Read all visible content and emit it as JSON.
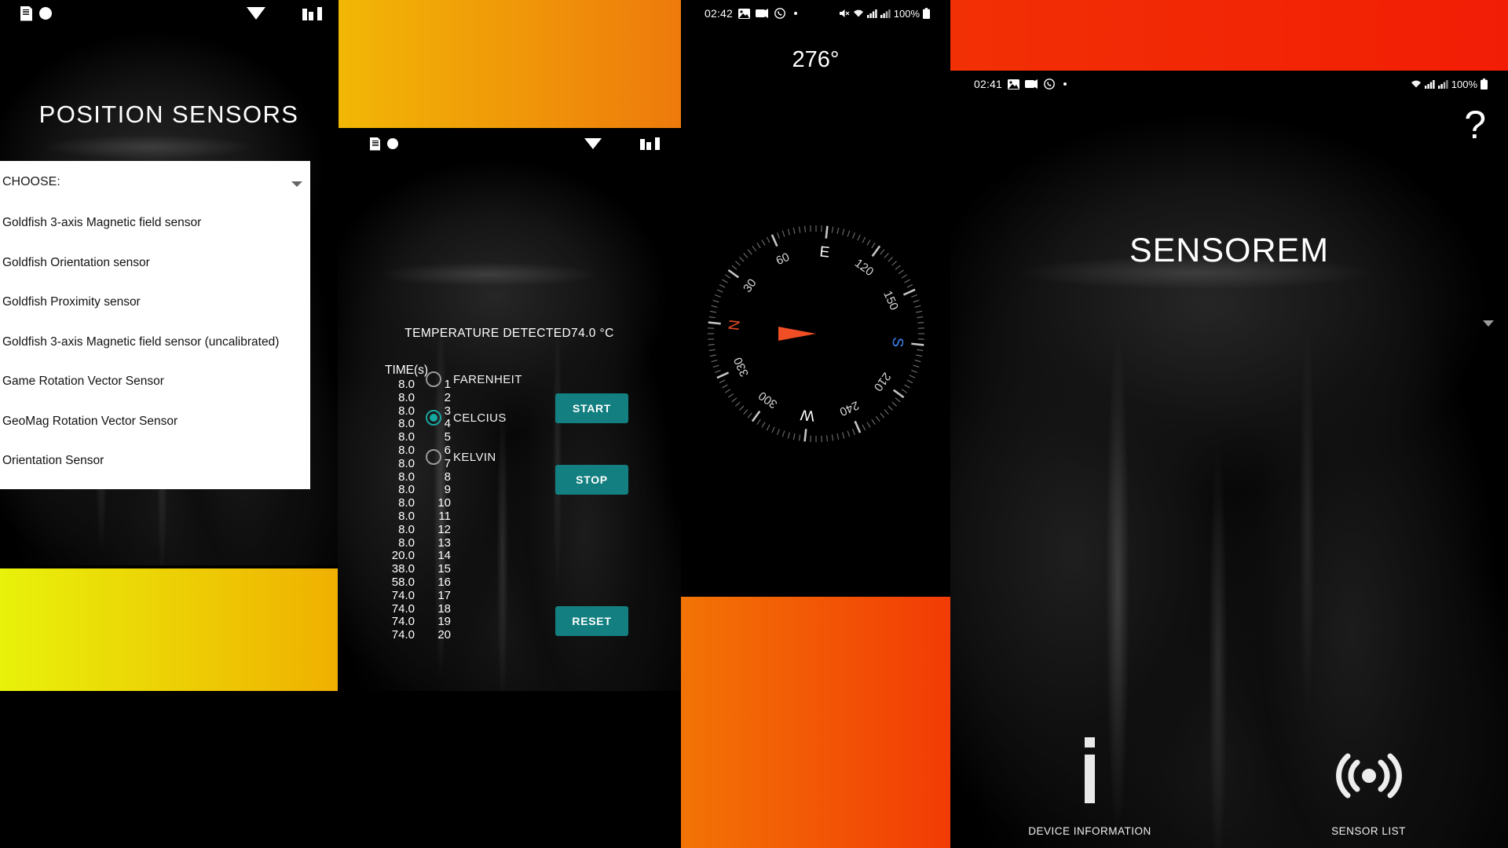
{
  "panel_position_sensors": {
    "status_bar": {
      "icons": [
        "sim-card-icon",
        "record-dot-icon",
        "wifi-icon",
        "signal-bars-icon"
      ]
    },
    "title": "POSITION SENSORS",
    "dropdown": {
      "label": "CHOOSE:",
      "caret_icon": "chevron-down-icon",
      "options": [
        "Goldfish 3-axis Magnetic field sensor",
        "Goldfish Orientation sensor",
        "Goldfish Proximity sensor",
        "Goldfish 3-axis Magnetic field sensor (uncalibrated)",
        "Game Rotation Vector Sensor",
        "GeoMag Rotation Vector Sensor",
        "Orientation Sensor"
      ]
    }
  },
  "panel_temperature": {
    "status_bar": {
      "icons": [
        "sim-card-icon",
        "record-dot-icon",
        "wifi-icon",
        "signal-bars-icon"
      ]
    },
    "detected_label": "TEMPERATURE DETECTED74.0 °C",
    "units": [
      {
        "label": "FARENHEIT",
        "selected": false
      },
      {
        "label": "CELCIUS",
        "selected": true
      },
      {
        "label": "KELVIN",
        "selected": false
      }
    ],
    "accent_color": "#16a8a0",
    "button_color": "#137f80",
    "table": {
      "header": "TIME(s)",
      "rows": [
        {
          "value": "8.0",
          "index": "1"
        },
        {
          "value": "8.0",
          "index": "2"
        },
        {
          "value": "8.0",
          "index": "3"
        },
        {
          "value": "8.0",
          "index": "4"
        },
        {
          "value": "8.0",
          "index": "5"
        },
        {
          "value": "8.0",
          "index": "6"
        },
        {
          "value": "8.0",
          "index": "7"
        },
        {
          "value": "8.0",
          "index": "8"
        },
        {
          "value": "8.0",
          "index": "9"
        },
        {
          "value": "8.0",
          "index": "10"
        },
        {
          "value": "8.0",
          "index": "11"
        },
        {
          "value": "8.0",
          "index": "12"
        },
        {
          "value": "8.0",
          "index": "13"
        },
        {
          "value": "20.0",
          "index": "14"
        },
        {
          "value": "38.0",
          "index": "15"
        },
        {
          "value": "58.0",
          "index": "16"
        },
        {
          "value": "74.0",
          "index": "17"
        },
        {
          "value": "74.0",
          "index": "18"
        },
        {
          "value": "74.0",
          "index": "19"
        },
        {
          "value": "74.0",
          "index": "20"
        }
      ]
    },
    "buttons": {
      "start": "START",
      "stop": "STOP",
      "reset": "RESET"
    }
  },
  "panel_compass": {
    "status_bar": {
      "time": "02:42",
      "left_icons": [
        "photo-icon",
        "screenshot-icon",
        "whatsapp-icon",
        "more-dot-icon"
      ],
      "right_icons": [
        "mute-icon",
        "wifi-icon",
        "signal-bars-icon",
        "signal-bars-2-icon"
      ],
      "battery_percent": "100%",
      "battery_icon": "battery-full-icon"
    },
    "heading": "276°",
    "compass": {
      "cardinals": [
        {
          "label": "N",
          "angle": 0,
          "color": "#e04a22"
        },
        {
          "label": "E",
          "angle": 90,
          "color": "#ffffff"
        },
        {
          "label": "S",
          "angle": 180,
          "color": "#3d86f2"
        },
        {
          "label": "W",
          "angle": 270,
          "color": "#ffffff"
        }
      ],
      "degree_ticks": [
        "30",
        "60",
        "120",
        "150",
        "210",
        "240",
        "300",
        "330"
      ],
      "needle_color": "#f04e24",
      "rotation_deg": 276
    }
  },
  "panel_sensorem": {
    "status_bar": {
      "time": "02:41",
      "left_icons": [
        "photo-icon",
        "screenshot-icon",
        "whatsapp-icon",
        "more-dot-icon"
      ],
      "right_icons": [
        "wifi-icon",
        "signal-bars-icon",
        "signal-bars-2-icon"
      ],
      "battery_percent": "100%",
      "battery_icon": "battery-full-icon"
    },
    "help_icon": "question-mark-icon",
    "brand": "SENSOREM",
    "caret_icon": "chevron-down-icon",
    "bottom_nav": [
      {
        "icon": "info-icon",
        "label": "DEVICE INFORMATION"
      },
      {
        "icon": "sensor-wave-icon",
        "label": "SENSOR LIST"
      }
    ]
  },
  "gradients": {
    "strip_top_mid": {
      "from": "#f2b705",
      "to": "#ee7a0c"
    },
    "strip_top_right": {
      "from": "#f23005",
      "to": "#f21d05"
    },
    "strip_bottom_left": {
      "from": "#e8f20a",
      "to": "#f0b000"
    },
    "strip_bottom_mid": {
      "from": "#f27405",
      "to": "#f23b05"
    }
  }
}
